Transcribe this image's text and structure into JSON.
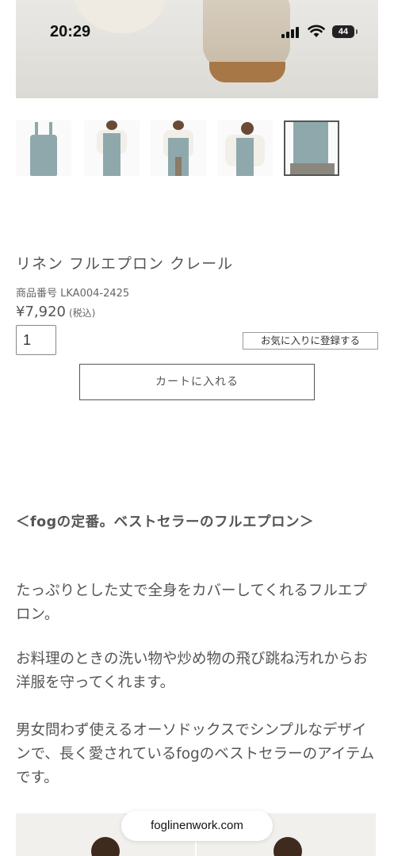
{
  "status_bar": {
    "time": "20:29",
    "battery": "44"
  },
  "product": {
    "title": "リネン フルエプロン クレール",
    "sku": "商品番号 LKA004-2425",
    "price": "¥7,920",
    "tax_note": "(税込)",
    "quantity": "1",
    "favorite_label": "お気に入りに登録する",
    "cart_label": "カートに入れる"
  },
  "thumbnails": [
    {
      "name": "thumb-apron-flat"
    },
    {
      "name": "thumb-model-front"
    },
    {
      "name": "thumb-model-back"
    },
    {
      "name": "thumb-model-seated"
    },
    {
      "name": "thumb-apron-detail",
      "selected": true
    }
  ],
  "description": {
    "heading": "＜fogの定番。ベストセラーのフルエプロン＞",
    "paragraphs": [
      "たっぷりとした丈で全身をカバーしてくれるフルエプロン。",
      "お料理のときの洗い物や炒め物の飛び跳ね汚れからお洋服を守ってくれます。",
      "男女問わず使えるオーソドックスでシンプルなデザインで、長く愛されているfogのベストセラーのアイテムです。"
    ]
  },
  "browser": {
    "url": "foglinenwork.com"
  },
  "colors": {
    "apron": "#8fa8ab",
    "text": "#555555"
  }
}
